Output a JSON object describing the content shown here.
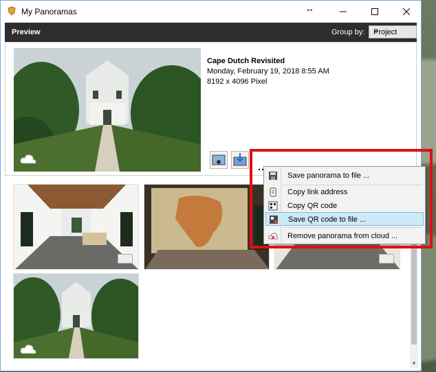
{
  "window": {
    "title": "My Panoramas"
  },
  "header": {
    "title": "Preview",
    "group_by_label": "Group by:",
    "group_by_value": "Project"
  },
  "selected": {
    "name": "Cape Dutch Revisited",
    "date": "Monday, February 19, 2018 8:55 AM",
    "size": "8192 x 4096 Pixel",
    "more": "..."
  },
  "menu": {
    "items": [
      {
        "label": "Save panorama to file ...",
        "icon": "floppy-icon"
      },
      {
        "label": "Copy link address",
        "icon": "link-icon"
      },
      {
        "label": "Copy QR code",
        "icon": "qr-icon"
      },
      {
        "label": "Save QR code to file ...",
        "icon": "save-qr-icon"
      },
      {
        "label": "Remove panorama from cloud ...",
        "icon": "cloud-remove-icon"
      }
    ],
    "highlighted_index": 3
  },
  "colors": {
    "highlight": "#e01010",
    "menu_selection": "#cde8f6",
    "header_bg": "#2d2d2d"
  }
}
